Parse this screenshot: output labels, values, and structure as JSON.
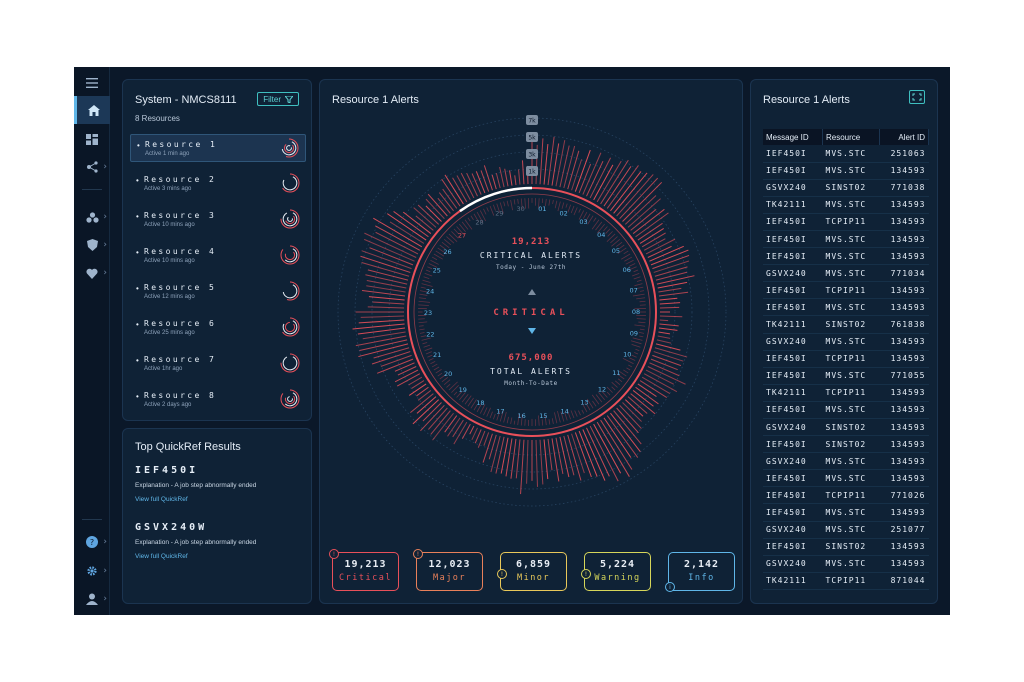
{
  "sidebar": {
    "items": [
      {
        "name": "menu",
        "icon": "hamburger-icon"
      },
      {
        "name": "home",
        "icon": "home-icon"
      },
      {
        "name": "dashboard",
        "icon": "dashboard-icon"
      },
      {
        "name": "network",
        "icon": "network-icon"
      },
      {
        "name": "cluster",
        "icon": "cluster-icon"
      },
      {
        "name": "security",
        "icon": "shield-icon"
      },
      {
        "name": "health",
        "icon": "heart-icon"
      },
      {
        "name": "help",
        "icon": "help-icon"
      },
      {
        "name": "settings",
        "icon": "gear-icon"
      },
      {
        "name": "user",
        "icon": "user-icon"
      }
    ]
  },
  "system_panel": {
    "title": "System - NMCS8111",
    "subtitle": "8 Resources",
    "filter_label": "Filter",
    "resources": [
      {
        "name": "Resource 1",
        "status": "Active 1 min ago",
        "rings": 4
      },
      {
        "name": "Resource 2",
        "status": "Active 3 mins ago",
        "rings": 2
      },
      {
        "name": "Resource 3",
        "status": "Active 10 mins ago",
        "rings": 4
      },
      {
        "name": "Resource 4",
        "status": "Active 10 mins ago",
        "rings": 3
      },
      {
        "name": "Resource 5",
        "status": "Active 12 mins ago",
        "rings": 2
      },
      {
        "name": "Resource 6",
        "status": "Active 25 mins ago",
        "rings": 3
      },
      {
        "name": "Resource 7",
        "status": "Active 1hr ago",
        "rings": 2
      },
      {
        "name": "Resource 8",
        "status": "Active 2 days ago",
        "rings": 4
      }
    ]
  },
  "quickref": {
    "title": "Top QuickRef Results",
    "results": [
      {
        "code": "IEF450I",
        "explanation": "Explanation - A job step abnormally ended",
        "link": "View full QuickRef"
      },
      {
        "code": "GSVX240W",
        "explanation": "Explanation - A job step abnormally ended",
        "link": "View full QuickRef"
      }
    ]
  },
  "radial": {
    "title": "Resource 1 Alerts",
    "scale_labels": [
      "7k",
      "5k",
      "3k",
      "1k"
    ],
    "critical_count": "19,213",
    "critical_label": "CRITICAL ALERTS",
    "critical_date": "Today - June 27th",
    "status_word": "CRITICAL",
    "total_count": "675,000",
    "total_label": "TOTAL ALERTS",
    "total_period": "Month-To-Date",
    "days": [
      "01",
      "02",
      "03",
      "04",
      "05",
      "06",
      "07",
      "08",
      "09",
      "10",
      "11",
      "12",
      "13",
      "14",
      "15",
      "16",
      "17",
      "18",
      "19",
      "20",
      "21",
      "22",
      "23",
      "24",
      "25",
      "26",
      "27",
      "28",
      "29",
      "30"
    ],
    "colors": {
      "critical": "#e8505a",
      "accent": "#5fb6e8"
    }
  },
  "severity": [
    {
      "count": "19,213",
      "label": "Critical",
      "color": "#e8505a",
      "icon": "critical-icon",
      "glyph": "!"
    },
    {
      "count": "12,023",
      "label": "Major",
      "color": "#e8805a",
      "icon": "major-icon",
      "glyph": "!"
    },
    {
      "count": "6,859",
      "label": "Minor",
      "color": "#e8c85a",
      "icon": "warning-triangle-icon",
      "glyph": "!"
    },
    {
      "count": "5,224",
      "label": "Warning",
      "color": "#d6d65a",
      "icon": "warning-icon",
      "glyph": "!"
    },
    {
      "count": "2,142",
      "label": "Info",
      "color": "#5fb6e8",
      "icon": "info-icon",
      "glyph": "i"
    }
  ],
  "alerts_table": {
    "title": "Resource 1 Alerts",
    "columns": [
      "Message ID",
      "Resource",
      "Alert ID"
    ],
    "rows": [
      [
        "IEF450I",
        "MVS.STC",
        "251063"
      ],
      [
        "IEF450I",
        "MVS.STC",
        "134593"
      ],
      [
        "GSVX240",
        "SINST02",
        "771038"
      ],
      [
        "TK42111",
        "MVS.STC",
        "134593"
      ],
      [
        "IEF450I",
        "TCPIP11",
        "134593"
      ],
      [
        "IEF450I",
        "MVS.STC",
        "134593"
      ],
      [
        "IEF450I",
        "MVS.STC",
        "134593"
      ],
      [
        "GSVX240",
        "MVS.STC",
        "771034"
      ],
      [
        "IEF450I",
        "TCPIP11",
        "134593"
      ],
      [
        "IEF450I",
        "MVS.STC",
        "134593"
      ],
      [
        "TK42111",
        "SINST02",
        "761838"
      ],
      [
        "GSVX240",
        "MVS.STC",
        "134593"
      ],
      [
        "IEF450I",
        "TCPIP11",
        "134593"
      ],
      [
        "IEF450I",
        "MVS.STC",
        "771055"
      ],
      [
        "TK42111",
        "TCPIP11",
        "134593"
      ],
      [
        "IEF450I",
        "MVS.STC",
        "134593"
      ],
      [
        "GSVX240",
        "SINST02",
        "134593"
      ],
      [
        "IEF450I",
        "SINST02",
        "134593"
      ],
      [
        "GSVX240",
        "MVS.STC",
        "134593"
      ],
      [
        "IEF450I",
        "MVS.STC",
        "134593"
      ],
      [
        "IEF450I",
        "TCPIP11",
        "771026"
      ],
      [
        "IEF450I",
        "MVS.STC",
        "134593"
      ],
      [
        "GSVX240",
        "MVS.STC",
        "251077"
      ],
      [
        "IEF450I",
        "SINST02",
        "134593"
      ],
      [
        "GSVX240",
        "MVS.STC",
        "134593"
      ],
      [
        "TK42111",
        "TCPIP11",
        "871044"
      ]
    ]
  }
}
